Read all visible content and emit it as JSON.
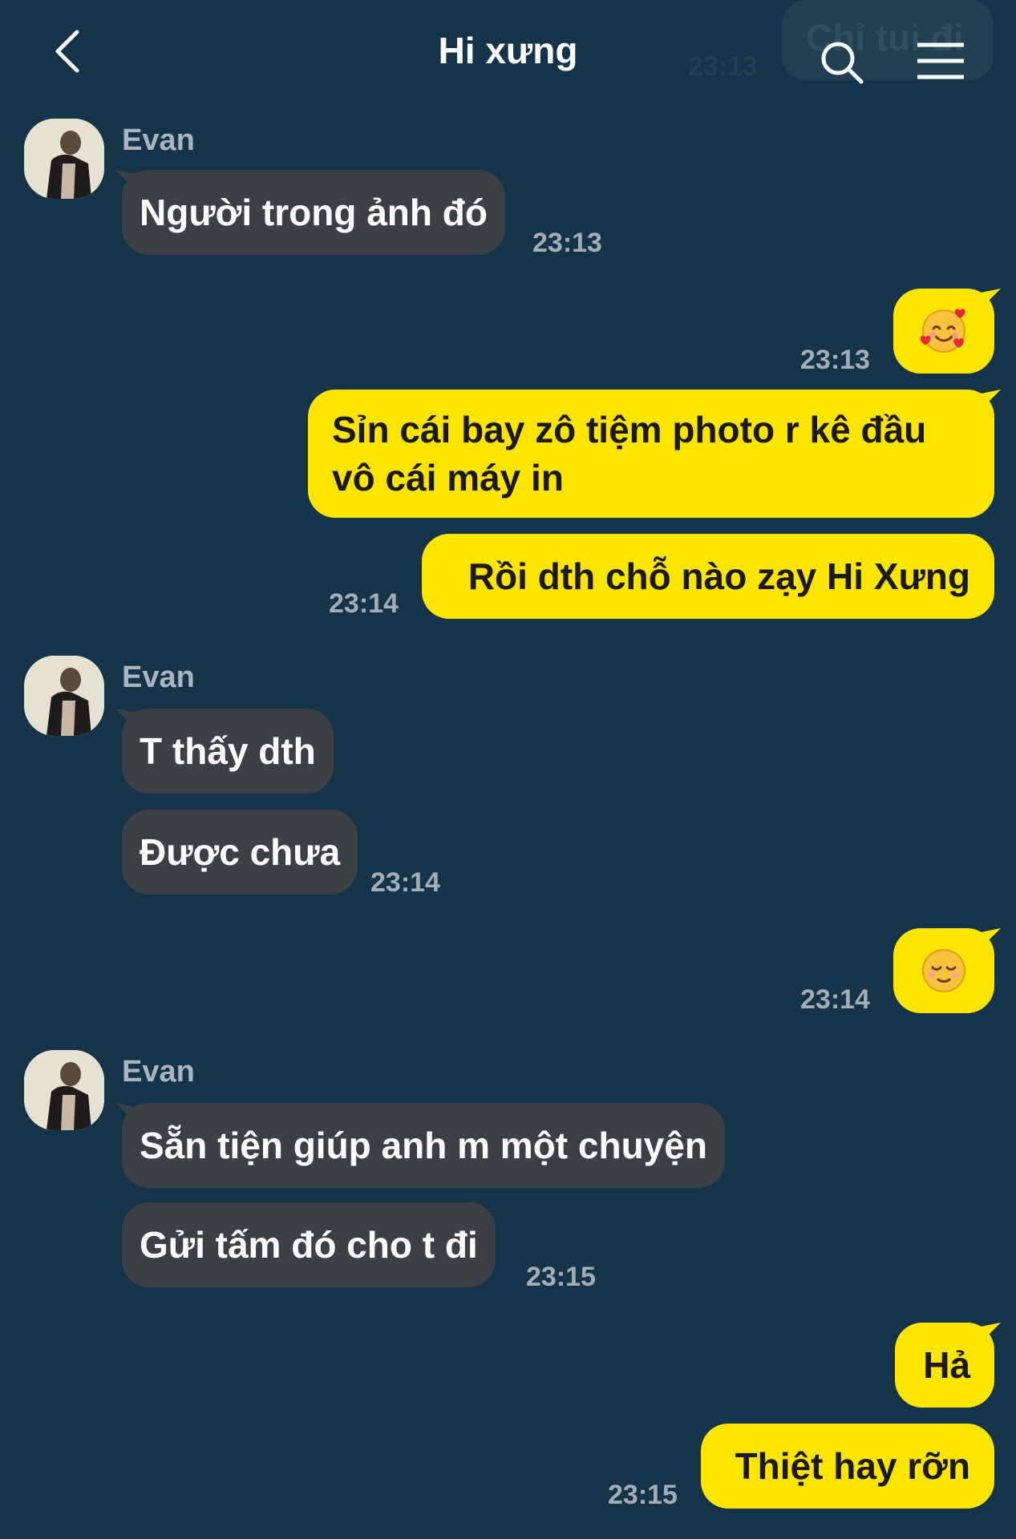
{
  "header": {
    "title": "Hi xưng",
    "faded_bubble_text": "Chỉ tui đi",
    "faded_time": "23:13"
  },
  "colors": {
    "background": "#163449",
    "incoming_bubble": "#3c3f44",
    "outgoing_bubble": "#fee500",
    "timestamp": "#a3adb8"
  },
  "messages": [
    {
      "from": "Evan",
      "text": "Người trong ảnh đó",
      "time": "23:13"
    },
    {
      "from": "me",
      "emoji": "smiling-face-with-hearts",
      "time": "23:13"
    },
    {
      "from": "me",
      "text": "Sỉn cái bay zô tiệm photo r kê đầu vô cái máy in"
    },
    {
      "from": "me",
      "text": "Rồi dth chỗ nào zạy Hi Xưng",
      "time": "23:14"
    },
    {
      "from": "Evan",
      "text": "T thấy dth"
    },
    {
      "from": "Evan",
      "text": "Được chưa",
      "time": "23:14"
    },
    {
      "from": "me",
      "emoji": "relieved-face",
      "time": "23:14"
    },
    {
      "from": "Evan",
      "text": "Sẵn tiện giúp anh m một chuyện"
    },
    {
      "from": "Evan",
      "text": "Gửi tấm đó cho t đi",
      "time": "23:15"
    },
    {
      "from": "me",
      "text": "Hả"
    },
    {
      "from": "me",
      "text": "Thiệt hay rỡn",
      "time": "23:15"
    }
  ],
  "sender_name": "Evan"
}
